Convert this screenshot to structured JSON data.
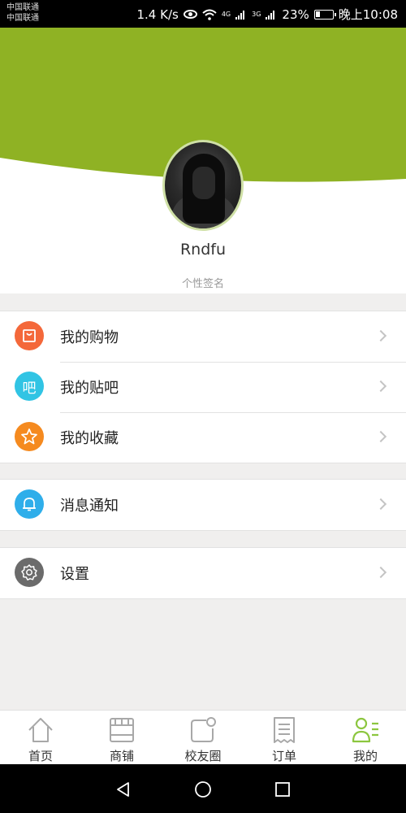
{
  "status_bar": {
    "carrier_1": "中国联通",
    "carrier_2": "中国联通",
    "speed": "1.4 K/s",
    "net_4g": "4G",
    "net_3g": "3G",
    "battery": "23%",
    "time": "晚上10:08"
  },
  "profile": {
    "username": "Rndfu",
    "signature": "个性签名"
  },
  "menu": {
    "groups": [
      {
        "items": [
          {
            "label": "我的购物",
            "icon": "shopping-bag-icon",
            "color": "#f4683a"
          },
          {
            "label": "我的贴吧",
            "icon": "forum-icon",
            "color": "#31c4e4"
          },
          {
            "label": "我的收藏",
            "icon": "star-icon",
            "color": "#f58a1f"
          }
        ]
      },
      {
        "items": [
          {
            "label": "消息通知",
            "icon": "bell-icon",
            "color": "#2faeea"
          }
        ]
      },
      {
        "items": [
          {
            "label": "设置",
            "icon": "gear-icon",
            "color": "#6b6b6b"
          }
        ]
      }
    ],
    "forum_icon_glyph": "吧"
  },
  "tabs": [
    {
      "label": "首页",
      "icon": "home-icon"
    },
    {
      "label": "商铺",
      "icon": "store-icon"
    },
    {
      "label": "校友圈",
      "icon": "moments-icon"
    },
    {
      "label": "订单",
      "icon": "order-icon"
    },
    {
      "label": "我的",
      "icon": "profile-icon",
      "active": true
    }
  ],
  "colors": {
    "brand_green": "#8fb224",
    "active_tab": "#8cc63f",
    "inactive_tab_icon": "#a8a8a8"
  }
}
